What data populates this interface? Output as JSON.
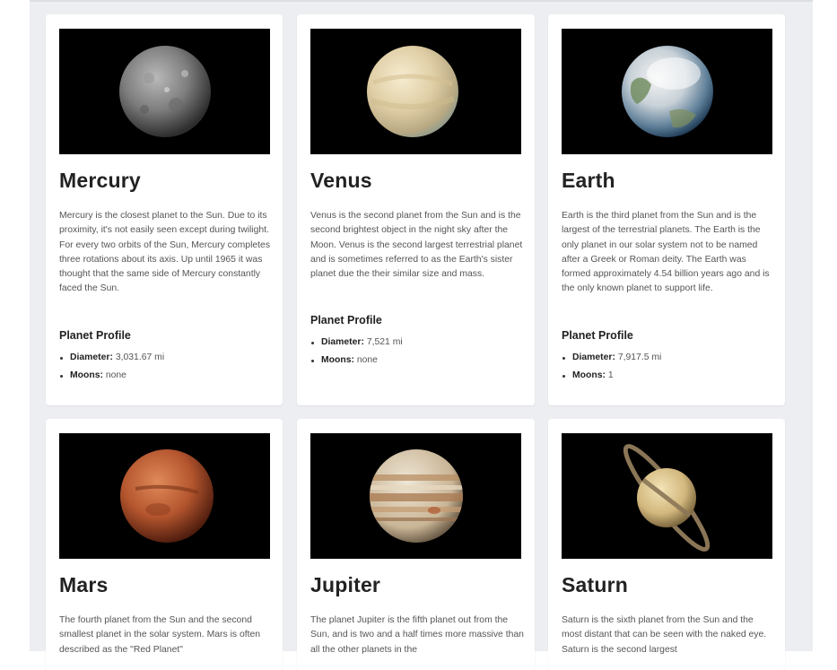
{
  "planets": [
    {
      "name": "Mercury",
      "description": "Mercury is the closest planet to the Sun. Due to its proximity, it's not easily seen except during twilight. For every two orbits of the Sun, Mercury completes three rotations about its axis. Up until 1965 it was thought that the same side of Mercury constantly faced the Sun.",
      "profile_heading": "Planet Profile",
      "diameter_label": "Diameter:",
      "diameter": "3,031.67 mi",
      "moons_label": "Moons:",
      "moons": "none"
    },
    {
      "name": "Venus",
      "description": "Venus is the second planet from the Sun and is the second brightest object in the night sky after the Moon. Venus is the second largest terrestrial planet and is sometimes referred to as the Earth's sister planet due the their similar size and mass.",
      "profile_heading": "Planet Profile",
      "diameter_label": "Diameter:",
      "diameter": "7,521 mi",
      "moons_label": "Moons:",
      "moons": "none"
    },
    {
      "name": "Earth",
      "description": "Earth is the third planet from the Sun and is the largest of the terrestrial planets. The Earth is the only planet in our solar system not to be named after a Greek or Roman deity. The Earth was formed approximately 4.54 billion years ago and is the only known planet to support life.",
      "profile_heading": "Planet Profile",
      "diameter_label": "Diameter:",
      "diameter": "7,917.5 mi",
      "moons_label": "Moons:",
      "moons": "1"
    },
    {
      "name": "Mars",
      "description": "The fourth planet from the Sun and the second smallest planet in the solar system. Mars is often described as the \"Red Planet\""
    },
    {
      "name": "Jupiter",
      "description": "The planet Jupiter is the fifth planet out from the Sun, and is two and a half times more massive than all the other planets in the"
    },
    {
      "name": "Saturn",
      "description": "Saturn is the sixth planet from the Sun and the most distant that can be seen with the naked eye. Saturn is the second largest"
    }
  ]
}
